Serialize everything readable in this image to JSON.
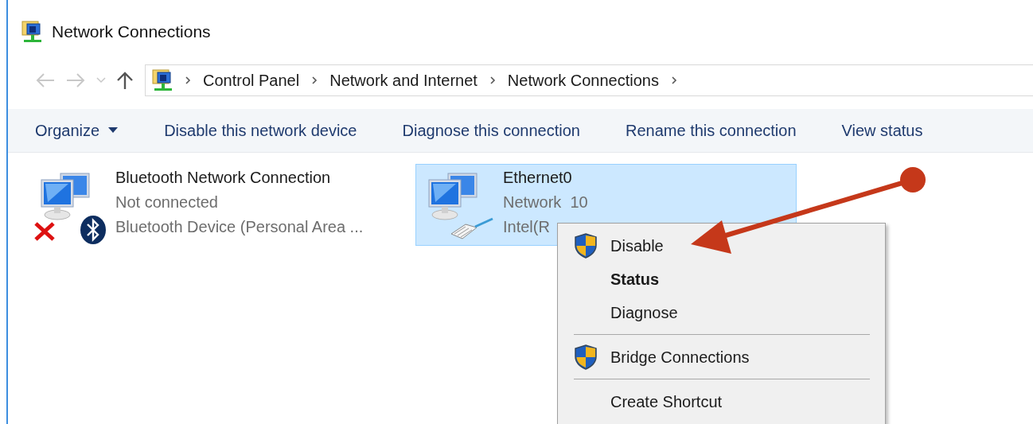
{
  "window": {
    "title": "Network Connections"
  },
  "navigation": {
    "back": {
      "disabled": true
    },
    "forward": {
      "disabled": true
    },
    "recent": {
      "disabled": true
    },
    "up": {
      "disabled": false
    }
  },
  "address_bar": {
    "crumbs": [
      "Control Panel",
      "Network and Internet",
      "Network Connections"
    ]
  },
  "toolbar": {
    "items": [
      {
        "label": "Organize",
        "dropdown": true
      },
      {
        "label": "Disable this network device",
        "dropdown": false
      },
      {
        "label": "Diagnose this connection",
        "dropdown": false
      },
      {
        "label": "Rename this connection",
        "dropdown": false
      },
      {
        "label": "View status",
        "dropdown": false
      }
    ]
  },
  "connections": [
    {
      "kind": "bluetooth",
      "name": "Bluetooth Network Connection",
      "status": "Not connected",
      "device": "Bluetooth Device (Personal Area ...",
      "connected": false,
      "selected": false
    },
    {
      "kind": "ethernet",
      "name": "Ethernet0",
      "status": "Network  10",
      "device": "Intel(R",
      "connected": true,
      "selected": true
    }
  ],
  "context_menu": {
    "items": [
      {
        "kind": "item",
        "label": "Disable",
        "shield": true,
        "default": false
      },
      {
        "kind": "item",
        "label": "Status",
        "shield": false,
        "default": true
      },
      {
        "kind": "item",
        "label": "Diagnose",
        "shield": false,
        "default": false
      },
      {
        "kind": "separator"
      },
      {
        "kind": "item",
        "label": "Bridge Connections",
        "shield": true,
        "default": false
      },
      {
        "kind": "separator"
      },
      {
        "kind": "item",
        "label": "Create Shortcut",
        "shield": false,
        "default": false
      }
    ]
  }
}
